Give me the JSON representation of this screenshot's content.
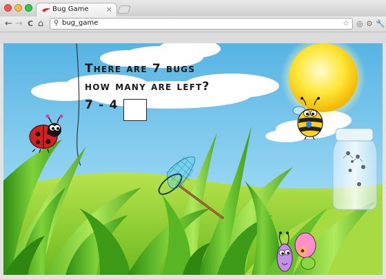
{
  "browser": {
    "tab_title": "Bug Game",
    "tab_close": "×",
    "address": "bug_game",
    "back": "←",
    "forward": "→",
    "reload": "C",
    "home": "⌂",
    "star": "☆",
    "search_glyph": "⚲",
    "ext1": "◎",
    "ext2": "⚙"
  },
  "game": {
    "question_line1": "There are 7 bugs",
    "question_line2": "how many are left?",
    "equation": "7 - 4 =",
    "answer": ""
  },
  "colors": {
    "sky": "#6ec0e6",
    "grass": "#4caf22",
    "sun": "#ffe23a",
    "ladybug": "#d81f1f"
  },
  "icons": [
    "ladybug-icon",
    "bee-icon",
    "butterfly-icon",
    "bug-net-icon",
    "jar-icon",
    "sun-icon",
    "cloud-icon"
  ]
}
